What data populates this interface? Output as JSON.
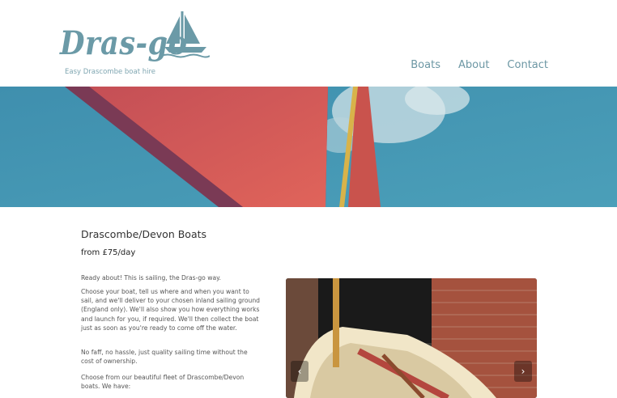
{
  "site": {
    "logo_text": "Dras-go",
    "tagline": "Easy Drascombe boat hire"
  },
  "nav": {
    "items": [
      "Boats",
      "About",
      "Contact"
    ]
  },
  "main": {
    "title": "Drascombe/Devon Boats",
    "price": "from £75/day",
    "paragraphs": [
      "Ready about! This is sailing, the Dras-go way.",
      "Choose your boat, tell us where and when you want to sail, and we'll deliver to your chosen inland sailing ground (England only). We'll also show you how everything works and launch for you, if required. We'll then collect the boat just as soon as you're ready to come off the water.",
      "No faff, no hassle, just quality sailing time without the cost of ownership.",
      "Choose from our beautiful fleet of Drascombe/Devon boats. We have:"
    ]
  },
  "carousel": {
    "prev_glyph": "‹",
    "next_glyph": "›"
  },
  "colors": {
    "brand": "#6b9aa7",
    "sky": "#4a98b3",
    "sail": "#d25a55"
  }
}
